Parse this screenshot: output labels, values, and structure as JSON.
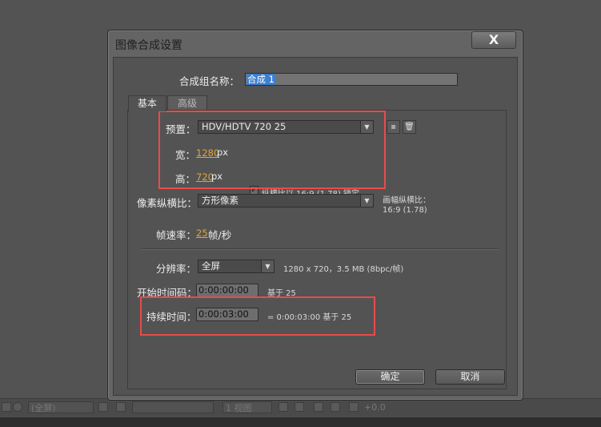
{
  "dialog": {
    "title": "图像合成设置",
    "close_label": "X"
  },
  "comp_name": {
    "label": "合成组名称：",
    "value": "合成 1"
  },
  "tabs": [
    {
      "label": "基本",
      "active": true
    },
    {
      "label": "高级",
      "active": false
    }
  ],
  "preset": {
    "label": "预置：",
    "value": "HDV/HDTV 720 25"
  },
  "width": {
    "label": "宽：",
    "value": "1280",
    "unit": "px"
  },
  "height": {
    "label": "高：",
    "value": "720",
    "unit": "px"
  },
  "lock_aspect": {
    "checked": true,
    "label": "纵横比以 16:9 (1.78) 锁定"
  },
  "pixel_aspect": {
    "label": "像素纵横比：",
    "value": "方形像素",
    "frame_aspect_label": "画幅纵横比：",
    "frame_aspect_value": "16:9 (1.78)"
  },
  "frame_rate": {
    "label": "帧速率：",
    "value": "25",
    "unit": "帧/秒"
  },
  "resolution": {
    "label": "分辨率：",
    "value": "全屏",
    "info": "1280 x 720，3.5 MB (8bpc/帧)"
  },
  "start_timecode": {
    "label": "开始时间码：",
    "value": "0:00:00:00",
    "note": "基于 25"
  },
  "duration": {
    "label": "持续时间：",
    "value": "0:00:03:00",
    "note": "= 0:00:03:00  基于 25"
  },
  "buttons": {
    "ok": "确定",
    "cancel": "取消"
  },
  "background_toolbar": {
    "resolution": "(全屏)",
    "views": "1 视图",
    "exposure": "+0.0"
  },
  "icons": {
    "save_preset": "save-preset-icon",
    "delete_preset": "trash-icon"
  },
  "colors": {
    "highlight_border": "#e84b4b",
    "accent_value": "#e2a53a"
  }
}
